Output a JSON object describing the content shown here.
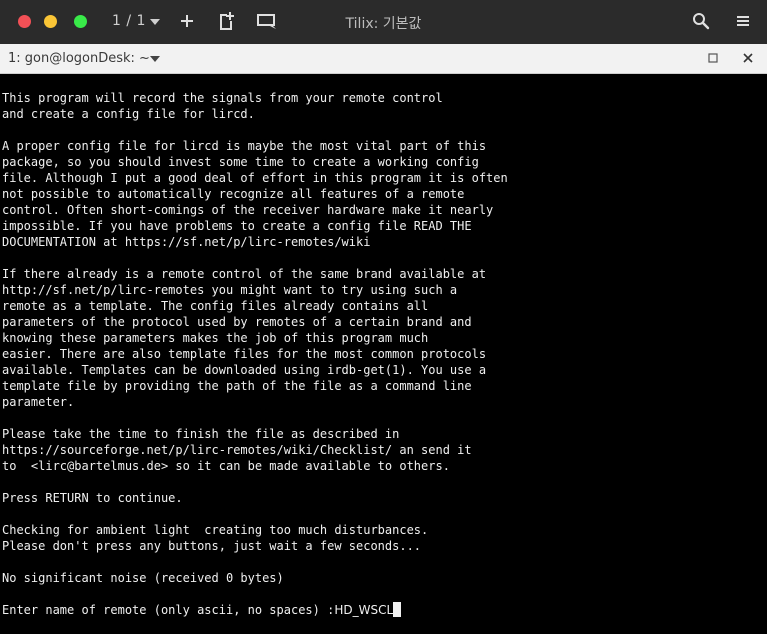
{
  "titlebar": {
    "session_counter": "1 / 1",
    "window_title": "Tilix: 기본값",
    "icons": {
      "close": "close-window-dot",
      "minimize": "minimize-window-dot",
      "maximize": "maximize-window-dot",
      "add": "plus-icon",
      "add_right": "split-add-icon",
      "sync": "sync-input-icon",
      "search": "search-icon",
      "menu": "hamburger-menu-icon"
    },
    "colors": {
      "close": "#f25056",
      "minimize": "#fac536",
      "maximize": "#39ea49"
    }
  },
  "terminal_header": {
    "title": "1: gon@logonDesk: ~"
  },
  "terminal": {
    "lines": [
      "This program will record the signals from your remote control",
      "and create a config file for lircd.",
      "",
      "A proper config file for lircd is maybe the most vital part of this",
      "package, so you should invest some time to create a working config",
      "file. Although I put a good deal of effort in this program it is often",
      "not possible to automatically recognize all features of a remote",
      "control. Often short-comings of the receiver hardware make it nearly",
      "impossible. If you have problems to create a config file READ THE",
      "DOCUMENTATION at https://sf.net/p/lirc-remotes/wiki",
      "",
      "If there already is a remote control of the same brand available at",
      "http://sf.net/p/lirc-remotes you might want to try using such a",
      "remote as a template. The config files already contains all",
      "parameters of the protocol used by remotes of a certain brand and",
      "knowing these parameters makes the job of this program much",
      "easier. There are also template files for the most common protocols",
      "available. Templates can be downloaded using irdb-get(1). You use a",
      "template file by providing the path of the file as a command line",
      "parameter.",
      "",
      "Please take the time to finish the file as described in",
      "https://sourceforge.net/p/lirc-remotes/wiki/Checklist/ an send it",
      "to  <lirc@bartelmus.de> so it can be made available to others.",
      "",
      "Press RETURN to continue.",
      "",
      "Checking for ambient light  creating too much disturbances.",
      "Please don't press any buttons, just wait a few seconds...",
      "",
      "No significant noise (received 0 bytes)",
      ""
    ],
    "prompt": "Enter name of remote (only ascii, no spaces) :",
    "input_value": "HD_WSCL"
  }
}
